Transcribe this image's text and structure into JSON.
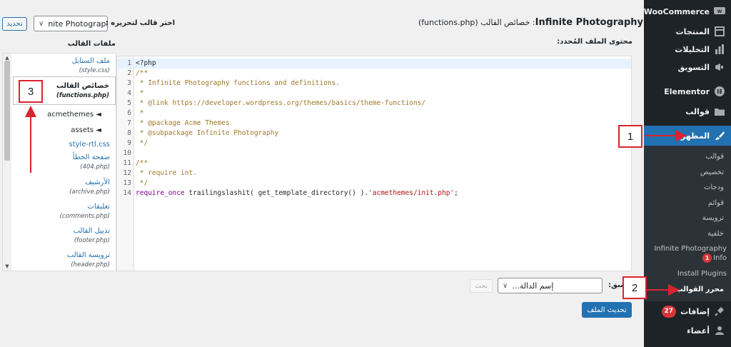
{
  "sidebar": {
    "items": [
      {
        "label": "WooCommerce",
        "icon": "woocommerce-icon"
      },
      {
        "label": "المنتجات",
        "icon": "products-box-icon"
      },
      {
        "label": "التحليلات",
        "icon": "bar-chart-icon"
      },
      {
        "label": "التسويق",
        "icon": "megaphone-icon"
      },
      {
        "label": "Elementor",
        "icon": "elementor-icon"
      },
      {
        "label": "قوالب",
        "icon": "folder-icon"
      },
      {
        "label": "المظهر",
        "icon": "paintbrush-icon"
      }
    ],
    "submenu": [
      {
        "label": "قوالب"
      },
      {
        "label": "تخصيص"
      },
      {
        "label": "ودجات"
      },
      {
        "label": "قوائم"
      },
      {
        "label": "ترويسة"
      },
      {
        "label": "خلفية"
      },
      {
        "label": "Infinite Photography Info",
        "badge": "1"
      },
      {
        "label": "Install Plugins"
      },
      {
        "label": "محرر القوالب"
      }
    ],
    "bottom": [
      {
        "label": "إضافات",
        "icon": "plugin-icon",
        "badge": "27"
      },
      {
        "label": "أعضاء",
        "icon": "users-icon"
      }
    ]
  },
  "header": {
    "title_prefix": "Infinite Photography",
    "title_rest": ": خصائص القالب (functions.php)",
    "select_label": "اختر قالب لتحريره :",
    "selected_theme": "nite Photography",
    "select_button": "تحديد"
  },
  "labels": {
    "selected_file_content": "محتوى الملف المُحدد:",
    "theme_files": "ملفات القالب",
    "documentation": "تنبق:",
    "lookup_placeholder": "إسم الدالة...",
    "lookup_button": "بحث",
    "update_button": "تحديث الملف"
  },
  "code": {
    "lines": [
      [
        {
          "t": "<?php",
          "c": "default"
        }
      ],
      [
        {
          "t": "/**",
          "c": "comment"
        }
      ],
      [
        {
          "t": " * Infinite Photography functions and definitions.",
          "c": "comment"
        }
      ],
      [
        {
          "t": " *",
          "c": "comment"
        }
      ],
      [
        {
          "t": " * @link https://developer.wordpress.org/themes/basics/theme-functions/",
          "c": "comment"
        }
      ],
      [
        {
          "t": " *",
          "c": "comment"
        }
      ],
      [
        {
          "t": " * @package Acme Themes",
          "c": "comment"
        }
      ],
      [
        {
          "t": " * @subpackage Infinite Photography",
          "c": "comment"
        }
      ],
      [
        {
          "t": " */",
          "c": "comment"
        }
      ],
      [
        {
          "t": "",
          "c": "default"
        }
      ],
      [
        {
          "t": "/**",
          "c": "comment"
        }
      ],
      [
        {
          "t": " * require int.",
          "c": "comment"
        }
      ],
      [
        {
          "t": " */",
          "c": "comment"
        }
      ],
      [
        {
          "t": "require_once",
          "c": "kw"
        },
        {
          "t": " trailingslashit( get_template_directory() ).",
          "c": "default"
        },
        {
          "t": "'acmethemes/init.php'",
          "c": "str"
        },
        {
          "t": ";",
          "c": "default"
        }
      ]
    ]
  },
  "files": [
    {
      "name": "ملف الستايل",
      "path": "(style.css)"
    },
    {
      "name": "خصائص القالب",
      "path": "(functions.php)",
      "current": true
    },
    {
      "folder": "acmethemes ◄"
    },
    {
      "folder": "assets ◄"
    },
    {
      "name": "style-rtl.css",
      "path": ""
    },
    {
      "name": "صفحة الخطأ",
      "path": "(404.php)"
    },
    {
      "name": "الأرشيف",
      "path": "(archive.php)"
    },
    {
      "name": "تعليقات",
      "path": "(comments.php)"
    },
    {
      "name": "تذييل القالب",
      "path": "(footer.php)"
    },
    {
      "name": "ترويسة القالب",
      "path": "(header.php)"
    }
  ],
  "callouts": [
    "1",
    "2",
    "3"
  ],
  "colors": {
    "sidebar_bg": "#1d2327",
    "active_blue": "#2271b1",
    "callout_red": "#d9242f",
    "badge_red": "#d63638"
  }
}
